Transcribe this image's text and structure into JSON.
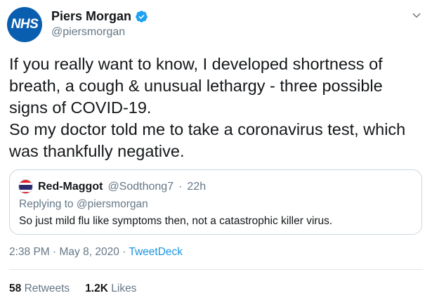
{
  "author": {
    "avatar_text": "NHS",
    "display_name": "Piers Morgan",
    "handle": "@piersmorgan",
    "avatar_color": "#0a5eb0",
    "verified_icon": "verified-badge-icon",
    "verified_color": "#1da1f2"
  },
  "tweet": {
    "lines": [
      "If you really want to know, I developed shortness of",
      "breath, a cough & unusual lethargy - three possible",
      "signs of COVID-19.",
      "So my doctor told me to take a coronavirus test, which",
      "was thankfully negative."
    ]
  },
  "quoted": {
    "display_name": "Red-Maggot",
    "handle": "@Sodthong7",
    "time": "22h",
    "replying_to": "Replying to @piersmorgan",
    "text": "So just mild flu like symptoms then, not a catastrophic killer virus.",
    "avatar_icon": "thai-flag-icon"
  },
  "meta": {
    "time": "2:38 PM",
    "date": "May 8, 2020",
    "source": "TweetDeck",
    "source_color": "#1b95e0"
  },
  "stats": {
    "retweets_count": "58",
    "retweets_label": "Retweets",
    "likes_count": "1.2K",
    "likes_label": "Likes"
  }
}
